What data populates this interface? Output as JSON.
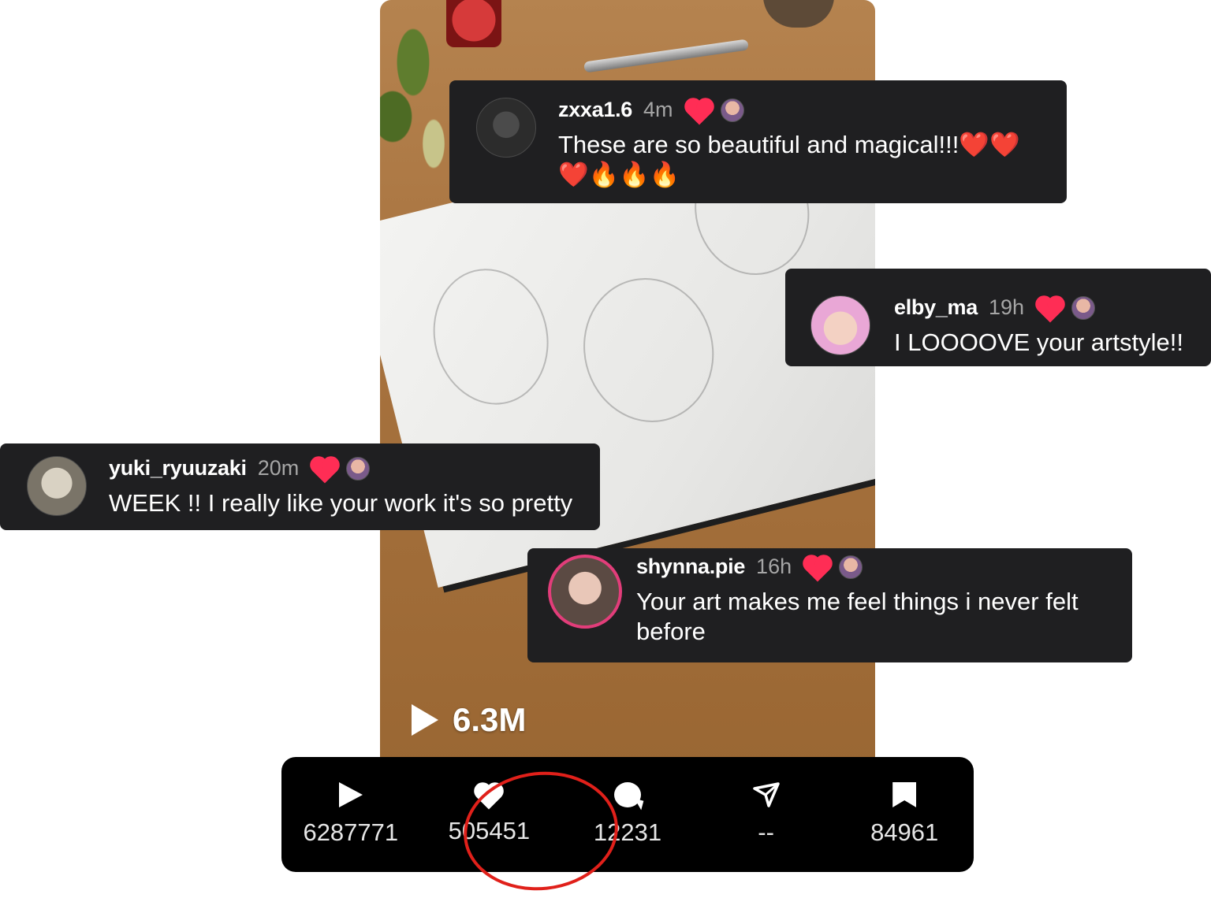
{
  "views": {
    "count": "6.3M"
  },
  "comments": [
    {
      "username": "zxxa1.6",
      "time": "4m",
      "text": "These are so beautiful and magical!!!❤️❤️❤️🔥🔥🔥"
    },
    {
      "username": "elby_ma",
      "time": "19h",
      "text": "I LOOOOVE your artstyle!!"
    },
    {
      "username": "yuki_ryuuzaki",
      "time": "20m",
      "text": "WEEK !! I really like your work it's so pretty"
    },
    {
      "username": "shynna.pie",
      "time": "16h",
      "text": "Your art makes me feel things i never felt before"
    }
  ],
  "stats": {
    "plays": "6287771",
    "likes": "505451",
    "comments": "12231",
    "shares": "--",
    "saves": "84961"
  },
  "colors": {
    "highlight_circle": "#e0201a",
    "heart": "#ff2d55"
  },
  "icons": [
    "play-icon",
    "heart-icon",
    "comment-icon",
    "send-icon",
    "bookmark-icon"
  ]
}
